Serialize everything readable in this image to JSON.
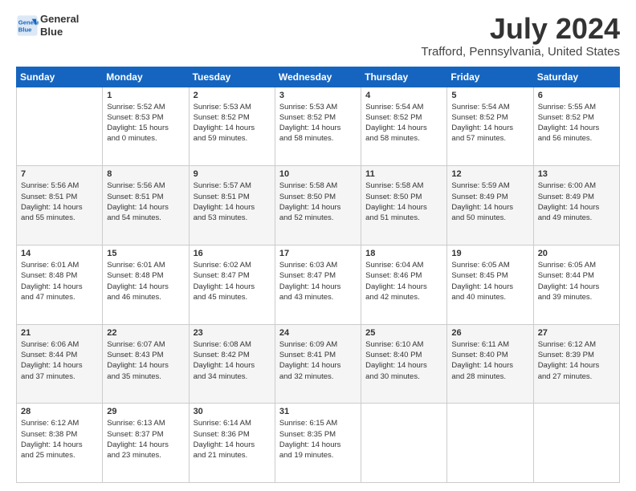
{
  "header": {
    "logo_line1": "General",
    "logo_line2": "Blue",
    "title": "July 2024",
    "subtitle": "Trafford, Pennsylvania, United States"
  },
  "days_of_week": [
    "Sunday",
    "Monday",
    "Tuesday",
    "Wednesday",
    "Thursday",
    "Friday",
    "Saturday"
  ],
  "weeks": [
    [
      {
        "day": "",
        "info": ""
      },
      {
        "day": "1",
        "info": "Sunrise: 5:52 AM\nSunset: 8:53 PM\nDaylight: 15 hours\nand 0 minutes."
      },
      {
        "day": "2",
        "info": "Sunrise: 5:53 AM\nSunset: 8:52 PM\nDaylight: 14 hours\nand 59 minutes."
      },
      {
        "day": "3",
        "info": "Sunrise: 5:53 AM\nSunset: 8:52 PM\nDaylight: 14 hours\nand 58 minutes."
      },
      {
        "day": "4",
        "info": "Sunrise: 5:54 AM\nSunset: 8:52 PM\nDaylight: 14 hours\nand 58 minutes."
      },
      {
        "day": "5",
        "info": "Sunrise: 5:54 AM\nSunset: 8:52 PM\nDaylight: 14 hours\nand 57 minutes."
      },
      {
        "day": "6",
        "info": "Sunrise: 5:55 AM\nSunset: 8:52 PM\nDaylight: 14 hours\nand 56 minutes."
      }
    ],
    [
      {
        "day": "7",
        "info": "Sunrise: 5:56 AM\nSunset: 8:51 PM\nDaylight: 14 hours\nand 55 minutes."
      },
      {
        "day": "8",
        "info": "Sunrise: 5:56 AM\nSunset: 8:51 PM\nDaylight: 14 hours\nand 54 minutes."
      },
      {
        "day": "9",
        "info": "Sunrise: 5:57 AM\nSunset: 8:51 PM\nDaylight: 14 hours\nand 53 minutes."
      },
      {
        "day": "10",
        "info": "Sunrise: 5:58 AM\nSunset: 8:50 PM\nDaylight: 14 hours\nand 52 minutes."
      },
      {
        "day": "11",
        "info": "Sunrise: 5:58 AM\nSunset: 8:50 PM\nDaylight: 14 hours\nand 51 minutes."
      },
      {
        "day": "12",
        "info": "Sunrise: 5:59 AM\nSunset: 8:49 PM\nDaylight: 14 hours\nand 50 minutes."
      },
      {
        "day": "13",
        "info": "Sunrise: 6:00 AM\nSunset: 8:49 PM\nDaylight: 14 hours\nand 49 minutes."
      }
    ],
    [
      {
        "day": "14",
        "info": "Sunrise: 6:01 AM\nSunset: 8:48 PM\nDaylight: 14 hours\nand 47 minutes."
      },
      {
        "day": "15",
        "info": "Sunrise: 6:01 AM\nSunset: 8:48 PM\nDaylight: 14 hours\nand 46 minutes."
      },
      {
        "day": "16",
        "info": "Sunrise: 6:02 AM\nSunset: 8:47 PM\nDaylight: 14 hours\nand 45 minutes."
      },
      {
        "day": "17",
        "info": "Sunrise: 6:03 AM\nSunset: 8:47 PM\nDaylight: 14 hours\nand 43 minutes."
      },
      {
        "day": "18",
        "info": "Sunrise: 6:04 AM\nSunset: 8:46 PM\nDaylight: 14 hours\nand 42 minutes."
      },
      {
        "day": "19",
        "info": "Sunrise: 6:05 AM\nSunset: 8:45 PM\nDaylight: 14 hours\nand 40 minutes."
      },
      {
        "day": "20",
        "info": "Sunrise: 6:05 AM\nSunset: 8:44 PM\nDaylight: 14 hours\nand 39 minutes."
      }
    ],
    [
      {
        "day": "21",
        "info": "Sunrise: 6:06 AM\nSunset: 8:44 PM\nDaylight: 14 hours\nand 37 minutes."
      },
      {
        "day": "22",
        "info": "Sunrise: 6:07 AM\nSunset: 8:43 PM\nDaylight: 14 hours\nand 35 minutes."
      },
      {
        "day": "23",
        "info": "Sunrise: 6:08 AM\nSunset: 8:42 PM\nDaylight: 14 hours\nand 34 minutes."
      },
      {
        "day": "24",
        "info": "Sunrise: 6:09 AM\nSunset: 8:41 PM\nDaylight: 14 hours\nand 32 minutes."
      },
      {
        "day": "25",
        "info": "Sunrise: 6:10 AM\nSunset: 8:40 PM\nDaylight: 14 hours\nand 30 minutes."
      },
      {
        "day": "26",
        "info": "Sunrise: 6:11 AM\nSunset: 8:40 PM\nDaylight: 14 hours\nand 28 minutes."
      },
      {
        "day": "27",
        "info": "Sunrise: 6:12 AM\nSunset: 8:39 PM\nDaylight: 14 hours\nand 27 minutes."
      }
    ],
    [
      {
        "day": "28",
        "info": "Sunrise: 6:12 AM\nSunset: 8:38 PM\nDaylight: 14 hours\nand 25 minutes."
      },
      {
        "day": "29",
        "info": "Sunrise: 6:13 AM\nSunset: 8:37 PM\nDaylight: 14 hours\nand 23 minutes."
      },
      {
        "day": "30",
        "info": "Sunrise: 6:14 AM\nSunset: 8:36 PM\nDaylight: 14 hours\nand 21 minutes."
      },
      {
        "day": "31",
        "info": "Sunrise: 6:15 AM\nSunset: 8:35 PM\nDaylight: 14 hours\nand 19 minutes."
      },
      {
        "day": "",
        "info": ""
      },
      {
        "day": "",
        "info": ""
      },
      {
        "day": "",
        "info": ""
      }
    ]
  ]
}
